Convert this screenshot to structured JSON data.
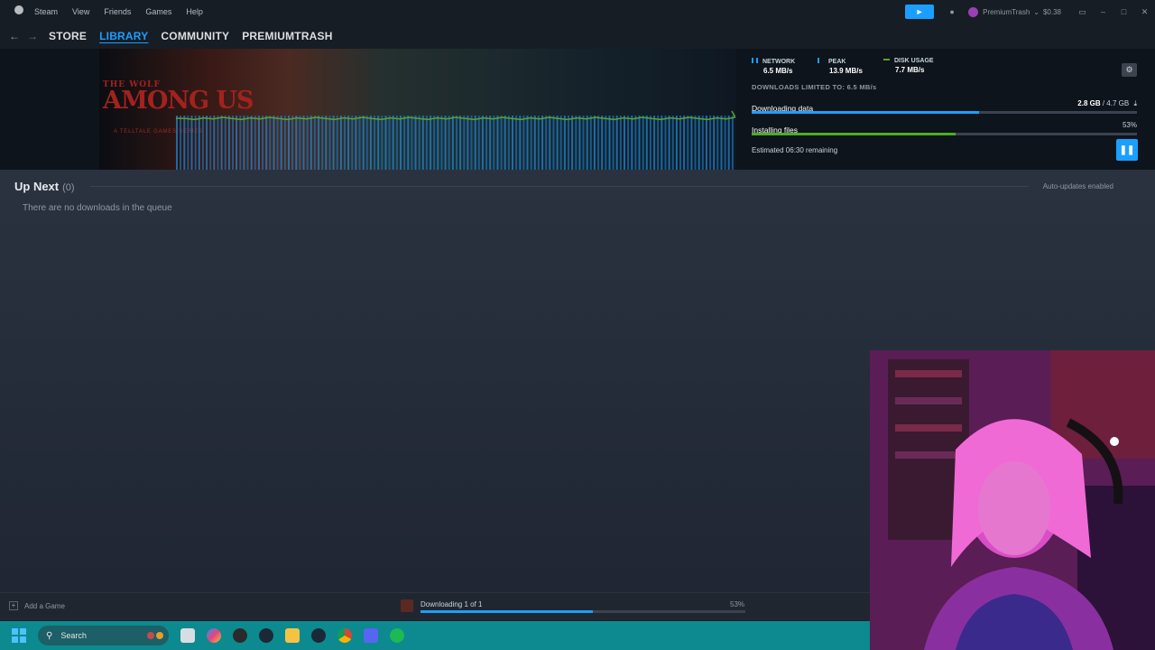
{
  "titlebar": {
    "menu": [
      "Steam",
      "View",
      "Friends",
      "Games",
      "Help"
    ],
    "account_label": "PremiumTrash",
    "account_balance": "$0.38"
  },
  "nav": {
    "tabs": [
      {
        "label": "STORE",
        "active": false
      },
      {
        "label": "LIBRARY",
        "active": true
      },
      {
        "label": "COMMUNITY",
        "active": false
      },
      {
        "label": "PREMIUMTRASH",
        "active": false
      }
    ]
  },
  "banner": {
    "game_title_line1": "THE WOLF",
    "game_title_line2": "AMONG US",
    "game_subtitle": "A TELLTALE GAMES SERIES",
    "stats": [
      {
        "label": "NETWORK",
        "value": "6.5 MB/s",
        "color": "#1a9fff"
      },
      {
        "label": "PEAK",
        "value": "13.9 MB/s",
        "color": "#1a9fff"
      },
      {
        "label": "DISK USAGE",
        "value": "7.7 MB/s",
        "color": "#5ba32b"
      }
    ],
    "limit_text": "DOWNLOADS LIMITED TO: 6.5 MB/s",
    "downloading_label": "Downloading data",
    "downloaded": "2.8 GB",
    "total": "/ 4.7 GB",
    "download_progress": 0.59,
    "installing_label": "Installing files",
    "install_percent": "53%",
    "install_progress": 0.53,
    "estimate": "Estimated 06:30 remaining"
  },
  "queue": {
    "title": "Up Next",
    "count": "(0)",
    "auto_updates": "Auto-updates enabled",
    "empty_message": "There are no downloads in the queue"
  },
  "bottombar": {
    "add_game": "Add a Game",
    "status": "Downloading 1 of 1",
    "percent": "53%",
    "progress": 0.53
  },
  "taskbar": {
    "search_placeholder": "Search",
    "apps": [
      "tray-icon",
      "file-explorer-icon",
      "copilot-icon",
      "obs-icon",
      "steam-icon",
      "folder-icon",
      "steam-icon",
      "chrome-icon",
      "discord-icon",
      "spotify-icon"
    ]
  },
  "colors": {
    "accent": "#1a9fff",
    "disk_green": "#5ba32b",
    "install_green": "#4caf1f",
    "taskbar": "#0c8a8f"
  }
}
